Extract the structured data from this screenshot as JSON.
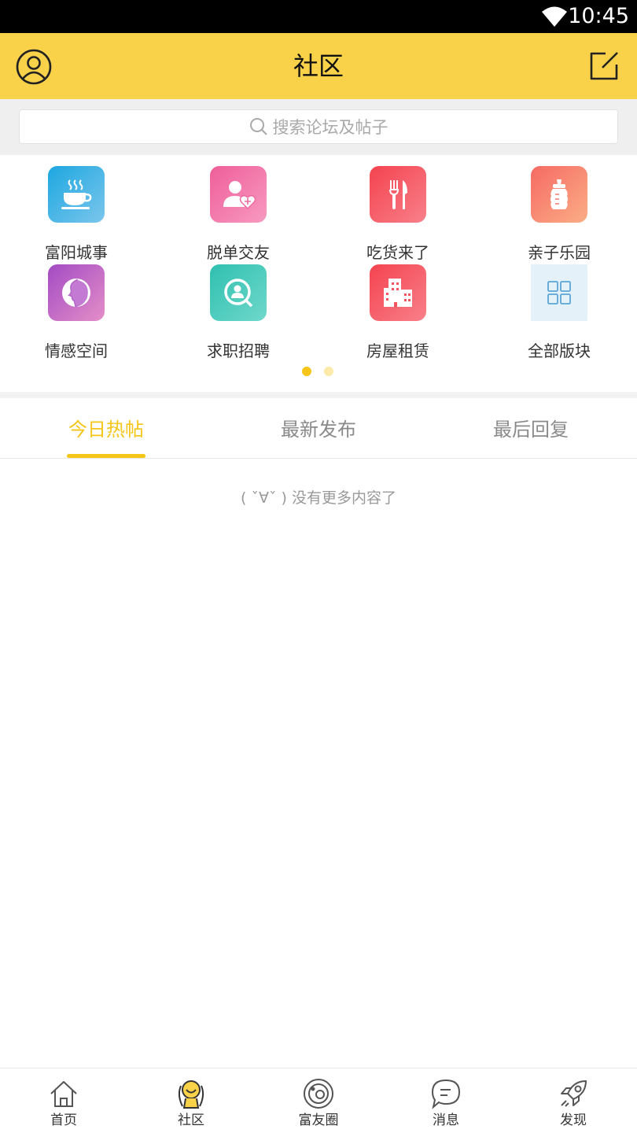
{
  "status": {
    "time": "10:45"
  },
  "header": {
    "title": "社区"
  },
  "search": {
    "placeholder": "搜索论坛及帖子"
  },
  "categories": [
    {
      "label": "富阳城事",
      "icon": "teacup-icon",
      "color": "#3aa6dc"
    },
    {
      "label": "脱单交友",
      "icon": "user-heart-icon",
      "color": "#f06aa0"
    },
    {
      "label": "吃货来了",
      "icon": "fork-knife-icon",
      "color": "#f5545e"
    },
    {
      "label": "亲子乐园",
      "icon": "baby-bottle-icon",
      "color": "#f77b6a"
    },
    {
      "label": "情感空间",
      "icon": "profile-face-icon",
      "color": "#b463c9"
    },
    {
      "label": "求职招聘",
      "icon": "search-user-icon",
      "color": "#3fc7b8"
    },
    {
      "label": "房屋租赁",
      "icon": "building-icon",
      "color": "#f5545e"
    },
    {
      "label": "全部版块",
      "icon": "grid-icon",
      "color": "#e4f1f9"
    }
  ],
  "pager": {
    "pages": 2,
    "current": 0
  },
  "tabs": [
    {
      "label": "今日热帖",
      "active": true
    },
    {
      "label": "最新发布",
      "active": false
    },
    {
      "label": "最后回复",
      "active": false
    }
  ],
  "empty_text": "( ˇ∀ˇ ) 没有更多内容了",
  "nav": [
    {
      "label": "首页",
      "icon": "home-icon",
      "active": false
    },
    {
      "label": "社区",
      "icon": "community-icon",
      "active": true
    },
    {
      "label": "富友圈",
      "icon": "planet-icon",
      "active": false
    },
    {
      "label": "消息",
      "icon": "message-icon",
      "active": false
    },
    {
      "label": "发现",
      "icon": "rocket-icon",
      "active": false
    }
  ],
  "colors": {
    "accent": "#f9d24a",
    "tab_active": "#f5c518",
    "text": "#333333"
  }
}
